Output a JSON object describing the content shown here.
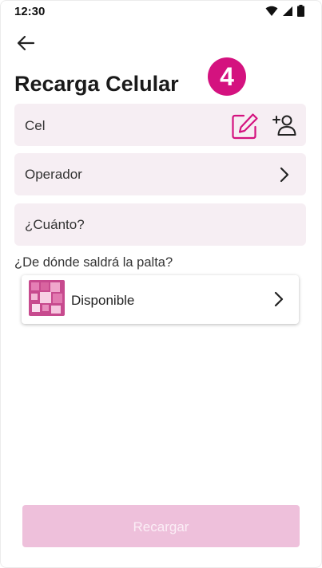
{
  "status_bar": {
    "time": "12:30",
    "icons": [
      "wifi-icon",
      "signal-icon",
      "battery-icon"
    ]
  },
  "header": {
    "back_icon": "arrow-left-icon",
    "title": "Recarga Celular",
    "step_badge": "4"
  },
  "form": {
    "phone_placeholder": "Cel",
    "phone_actions": [
      "edit-icon",
      "add-contact-icon"
    ],
    "operator_placeholder": "Operador",
    "amount_placeholder": "¿Cuánto?"
  },
  "source": {
    "question": "¿De dónde saldrá la palta?",
    "account_name": "Disponible"
  },
  "submit": {
    "label": "Recargar"
  },
  "colors": {
    "accent": "#d4127f",
    "field_bg": "#f6eef3",
    "button_disabled": "#eec0db"
  }
}
